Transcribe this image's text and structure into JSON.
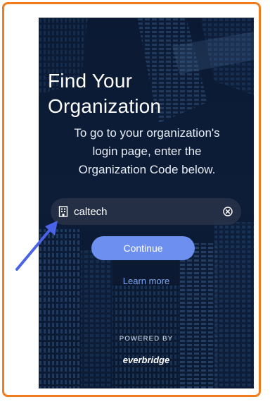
{
  "header": {
    "title_line1": "Find Your",
    "title_line2": "Organization"
  },
  "instructions": {
    "line1": "To go to your organization's",
    "line2": "login page, enter the",
    "line3": "Organization Code below."
  },
  "org_code": {
    "value": "caltech",
    "leading_icon": "building-icon",
    "trailing_icon": "clear-icon"
  },
  "actions": {
    "continue_label": "Continue",
    "learn_more_label": "Learn more"
  },
  "footer": {
    "powered_by": "POWERED BY",
    "brand": "everbridge"
  },
  "colors": {
    "frame_border": "#f07c1e",
    "continue_button": "#6d8ff0",
    "link": "#7da7f5",
    "annotation_arrow": "#4a63e8"
  }
}
